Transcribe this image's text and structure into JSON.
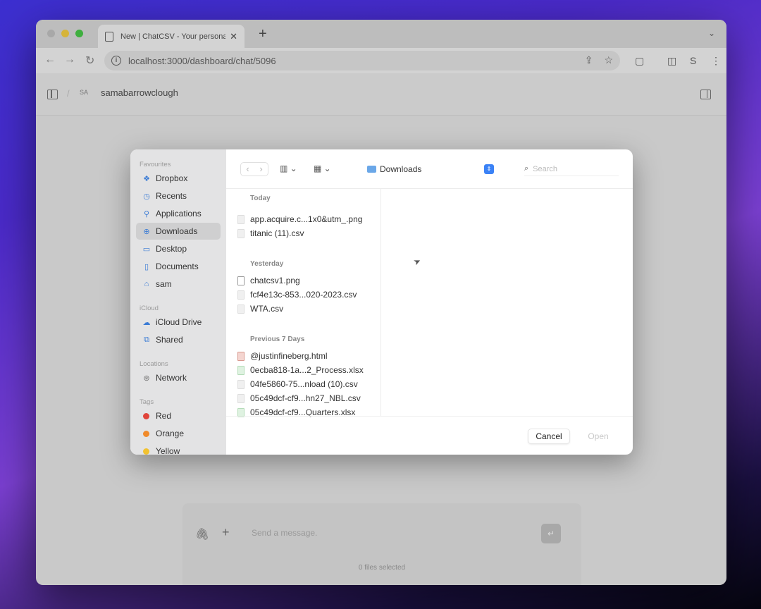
{
  "browser": {
    "tab_title": "New | ChatCSV - Your personal data analyst",
    "url": "localhost:3000/dashboard/chat/5096",
    "profile_initial": "S"
  },
  "app": {
    "avatar_initials": "SA",
    "username": "samabarrowclough"
  },
  "composer": {
    "placeholder": "Send a message.",
    "files_selected": "0 files selected"
  },
  "dialog": {
    "sidebar": {
      "favourites_label": "Favourites",
      "favourites": [
        "Dropbox",
        "Recents",
        "Applications",
        "Downloads",
        "Desktop",
        "Documents",
        "sam"
      ],
      "icloud_label": "iCloud",
      "icloud": [
        "iCloud Drive",
        "Shared"
      ],
      "locations_label": "Locations",
      "locations": [
        "Network"
      ],
      "tags_label": "Tags",
      "tags": [
        {
          "label": "Red",
          "color": "#e0443a"
        },
        {
          "label": "Orange",
          "color": "#f08a2a"
        },
        {
          "label": "Yellow",
          "color": "#f2c230"
        }
      ]
    },
    "location": "Downloads",
    "search_placeholder": "Search",
    "groups": {
      "today_label": "Today",
      "today": [
        "app.acquire.c...1x0&utm_.png",
        "titanic (11).csv"
      ],
      "yesterday_label": "Yesterday",
      "yesterday": [
        "chatcsv1.png",
        "fcf4e13c-853...020-2023.csv",
        "WTA.csv"
      ],
      "prev7_label": "Previous 7 Days",
      "prev7": [
        "@justinfineberg.html",
        "0ecba818-1a...2_Process.xlsx",
        "04fe5860-75...nload (10).csv",
        "05c49dcf-cf9...hn27_NBL.csv",
        "05c49dcf-cf9...Quarters.xlsx"
      ]
    },
    "cancel_label": "Cancel",
    "open_label": "Open"
  },
  "colors": {
    "accent": "#3b82f6",
    "selected_sidebar": "#cfcfd0"
  }
}
